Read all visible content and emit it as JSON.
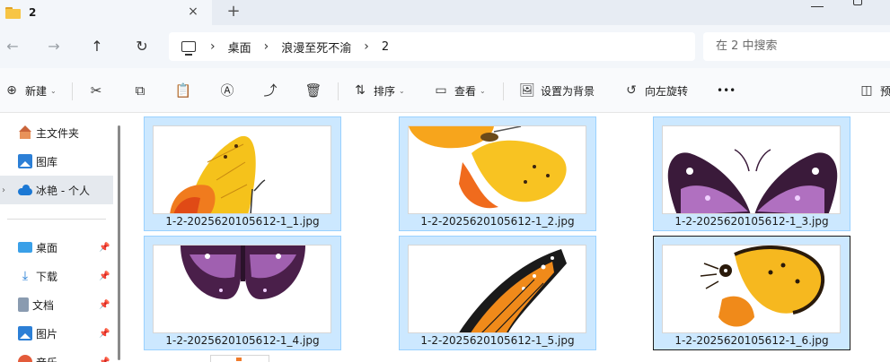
{
  "window": {
    "tab_title": "2",
    "close_label": "×",
    "new_tab_label": "+"
  },
  "nav": {
    "back": "←",
    "forward": "→",
    "up": "↑",
    "refresh": "↻"
  },
  "address": {
    "separator": "›",
    "crumbs": [
      "桌面",
      "浪漫至死不渝",
      "2"
    ]
  },
  "search": {
    "placeholder": "在 2 中搜索"
  },
  "toolbar": {
    "new_label": "新建",
    "sort_label": "排序",
    "view_label": "查看",
    "set_background_label": "设置为背景",
    "rotate_left_label": "向左旋转",
    "more_label": "•••",
    "preview_label": "预"
  },
  "sidebar": {
    "items": [
      {
        "label": "主文件夹",
        "icon": "home-icon"
      },
      {
        "label": "图库",
        "icon": "gallery-icon"
      },
      {
        "label": "冰艳 - 个人",
        "icon": "onedrive-icon"
      },
      {
        "label": "桌面",
        "icon": "desktop-icon"
      },
      {
        "label": "下载",
        "icon": "download-icon"
      },
      {
        "label": "文档",
        "icon": "documents-icon"
      },
      {
        "label": "图片",
        "icon": "pictures-icon"
      },
      {
        "label": "音乐",
        "icon": "music-icon"
      }
    ],
    "expand_glyph": "›",
    "pin_glyph": "📌"
  },
  "files": [
    {
      "name": "1-2-2025620105612-1_1.jpg"
    },
    {
      "name": "1-2-2025620105612-1_2.jpg"
    },
    {
      "name": "1-2-2025620105612-1_3.jpg"
    },
    {
      "name": "1-2-2025620105612-1_4.jpg"
    },
    {
      "name": "1-2-2025620105612-1_5.jpg"
    },
    {
      "name": "1-2-2025620105612-1_6.jpg"
    }
  ],
  "colors": {
    "selection_fill": "#cce8ff",
    "selection_border": "#99d1ff",
    "accent": "#1b78d4"
  }
}
